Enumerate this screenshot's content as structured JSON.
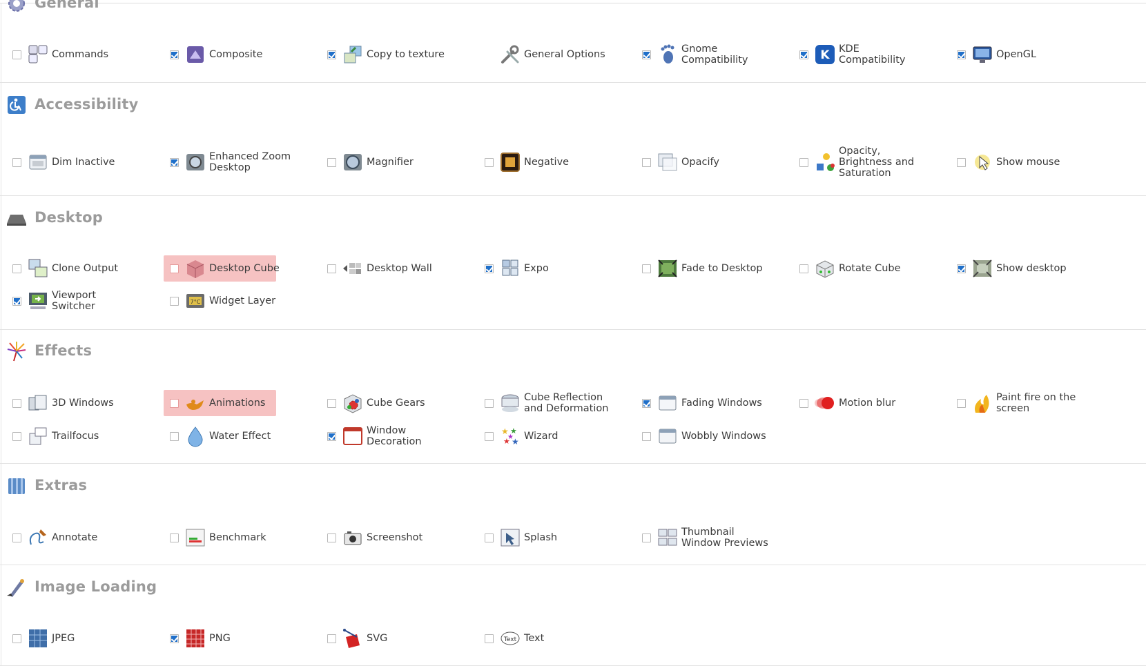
{
  "sections": [
    {
      "key": "general",
      "title": "General",
      "icon": "gear-icon",
      "plugins": [
        {
          "label": "Commands",
          "checked": false,
          "icon": "commands-icon"
        },
        {
          "label": "Composite",
          "checked": true,
          "icon": "composite-icon"
        },
        {
          "label": "Copy to texture",
          "checked": true,
          "icon": "copy-texture-icon"
        },
        {
          "label": "General Options",
          "checked": null,
          "icon": "tools-icon"
        },
        {
          "label": "Gnome\nCompatibility",
          "checked": true,
          "icon": "gnome-foot-icon"
        },
        {
          "label": "KDE\nCompatibility",
          "checked": true,
          "icon": "kde-icon"
        },
        {
          "label": "OpenGL",
          "checked": true,
          "icon": "monitor-icon"
        }
      ]
    },
    {
      "key": "accessibility",
      "title": "Accessibility",
      "icon": "accessibility-icon",
      "plugins": [
        {
          "label": "Dim Inactive",
          "checked": false,
          "icon": "dim-window-icon"
        },
        {
          "label": "Enhanced Zoom\nDesktop",
          "checked": true,
          "icon": "zoom-icon"
        },
        {
          "label": "Magnifier",
          "checked": false,
          "icon": "magnifier-icon"
        },
        {
          "label": "Negative",
          "checked": false,
          "icon": "negative-icon"
        },
        {
          "label": "Opacify",
          "checked": false,
          "icon": "opacify-icon"
        },
        {
          "label": "Opacity,\nBrightness and\nSaturation",
          "checked": false,
          "icon": "brightness-icon"
        },
        {
          "label": "Show mouse",
          "checked": false,
          "icon": "show-mouse-icon"
        }
      ]
    },
    {
      "key": "desktop",
      "title": "Desktop",
      "icon": "desktop-icon",
      "plugins": [
        {
          "label": "Clone Output",
          "checked": false,
          "icon": "clone-output-icon"
        },
        {
          "label": "Desktop Cube",
          "checked": false,
          "icon": "cube-icon",
          "highlight": true
        },
        {
          "label": "Desktop Wall",
          "checked": false,
          "icon": "wall-icon"
        },
        {
          "label": "Expo",
          "checked": true,
          "icon": "expo-icon"
        },
        {
          "label": "Fade to Desktop",
          "checked": false,
          "icon": "fade-desktop-icon"
        },
        {
          "label": "Rotate Cube",
          "checked": false,
          "icon": "rotate-cube-icon"
        },
        {
          "label": "Show desktop",
          "checked": true,
          "icon": "show-desktop-icon"
        },
        {
          "label": "Viewport\nSwitcher",
          "checked": true,
          "icon": "viewport-icon"
        },
        {
          "label": "Widget Layer",
          "checked": false,
          "icon": "widget-icon"
        }
      ]
    },
    {
      "key": "effects",
      "title": "Effects",
      "icon": "fireworks-icon",
      "plugins": [
        {
          "label": "3D Windows",
          "checked": false,
          "icon": "3d-windows-icon"
        },
        {
          "label": "Animations",
          "checked": false,
          "icon": "lamp-icon",
          "highlight": true
        },
        {
          "label": "Cube Gears",
          "checked": false,
          "icon": "gears-icon"
        },
        {
          "label": "Cube Reflection\nand Deformation",
          "checked": false,
          "icon": "reflection-icon"
        },
        {
          "label": "Fading Windows",
          "checked": true,
          "icon": "fading-window-icon"
        },
        {
          "label": "Motion blur",
          "checked": false,
          "icon": "motion-blur-icon"
        },
        {
          "label": "Paint fire on the\nscreen",
          "checked": false,
          "icon": "fire-icon"
        },
        {
          "label": "Trailfocus",
          "checked": false,
          "icon": "trailfocus-icon"
        },
        {
          "label": "Water Effect",
          "checked": false,
          "icon": "water-drop-icon"
        },
        {
          "label": "Window\nDecoration",
          "checked": true,
          "icon": "window-decoration-icon"
        },
        {
          "label": "Wizard",
          "checked": false,
          "icon": "wizard-stars-icon"
        },
        {
          "label": "Wobbly Windows",
          "checked": false,
          "icon": "wobbly-icon"
        }
      ]
    },
    {
      "key": "extras",
      "title": "Extras",
      "icon": "extras-icon",
      "plugins": [
        {
          "label": "Annotate",
          "checked": false,
          "icon": "annotate-icon"
        },
        {
          "label": "Benchmark",
          "checked": false,
          "icon": "benchmark-icon"
        },
        {
          "label": "Screenshot",
          "checked": false,
          "icon": "camera-icon"
        },
        {
          "label": "Splash",
          "checked": false,
          "icon": "splash-icon"
        },
        {
          "label": "Thumbnail\nWindow Previews",
          "checked": false,
          "icon": "thumbnail-icon"
        }
      ]
    },
    {
      "key": "image_loading",
      "title": "Image Loading",
      "icon": "paint-brush-icon",
      "plugins": [
        {
          "label": "JPEG",
          "checked": false,
          "icon": "jpeg-icon"
        },
        {
          "label": "PNG",
          "checked": true,
          "icon": "png-icon"
        },
        {
          "label": "SVG",
          "checked": false,
          "icon": "svg-icon"
        },
        {
          "label": "Text",
          "checked": false,
          "icon": "text-icon"
        }
      ]
    }
  ]
}
